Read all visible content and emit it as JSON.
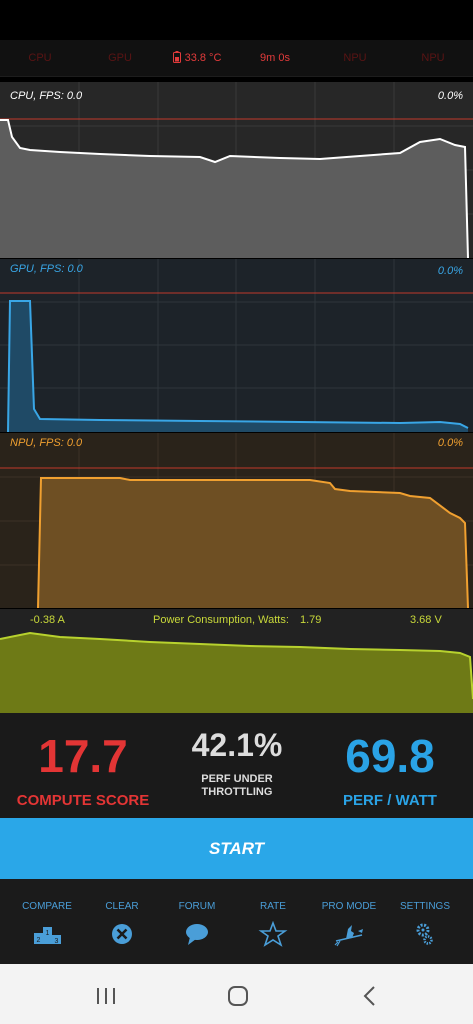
{
  "topbar": {
    "cpu": "CPU",
    "gpu": "GPU",
    "temperature": "33.8 °C",
    "time": "9m 0s",
    "npu1": "NPU",
    "npu2": "NPU"
  },
  "graphs": {
    "cpu": {
      "label": "CPU, FPS:  0.0",
      "percent": "0.0%",
      "color": "#ffffff"
    },
    "gpu": {
      "label": "GPU, FPS:  0.0",
      "percent": "0.0%",
      "color": "#39a6e6"
    },
    "npu": {
      "label": "NPU, FPS:  0.0",
      "percent": "0.0%",
      "color": "#f0a030"
    }
  },
  "power": {
    "current": "-0.38 A",
    "title": "Power Consumption, Watts:",
    "watts": "1.79",
    "voltage": "3.68 V",
    "color": "#b8d22e"
  },
  "scores": {
    "compute": {
      "value": "17.7",
      "label": "COMPUTE SCORE",
      "color": "#e33535"
    },
    "throttle": {
      "value": "42.1%",
      "label_line1": "PERF UNDER",
      "label_line2": "THROTTLING",
      "color": "#dddddd"
    },
    "perfwatt": {
      "value": "69.8",
      "label": "PERF / WATT",
      "color": "#2aa3e6"
    }
  },
  "start_button": {
    "label": "START",
    "color": "#2aa7e8"
  },
  "bottom_nav": {
    "items": [
      {
        "label": "COMPARE",
        "icon": "podium-icon"
      },
      {
        "label": "CLEAR",
        "icon": "clear-x-icon"
      },
      {
        "label": "FORUM",
        "icon": "chat-bubble-icon"
      },
      {
        "label": "RATE",
        "icon": "star-icon"
      },
      {
        "label": "PRO MODE",
        "icon": "witch-icon"
      },
      {
        "label": "SETTINGS",
        "icon": "gears-icon"
      }
    ]
  }
}
